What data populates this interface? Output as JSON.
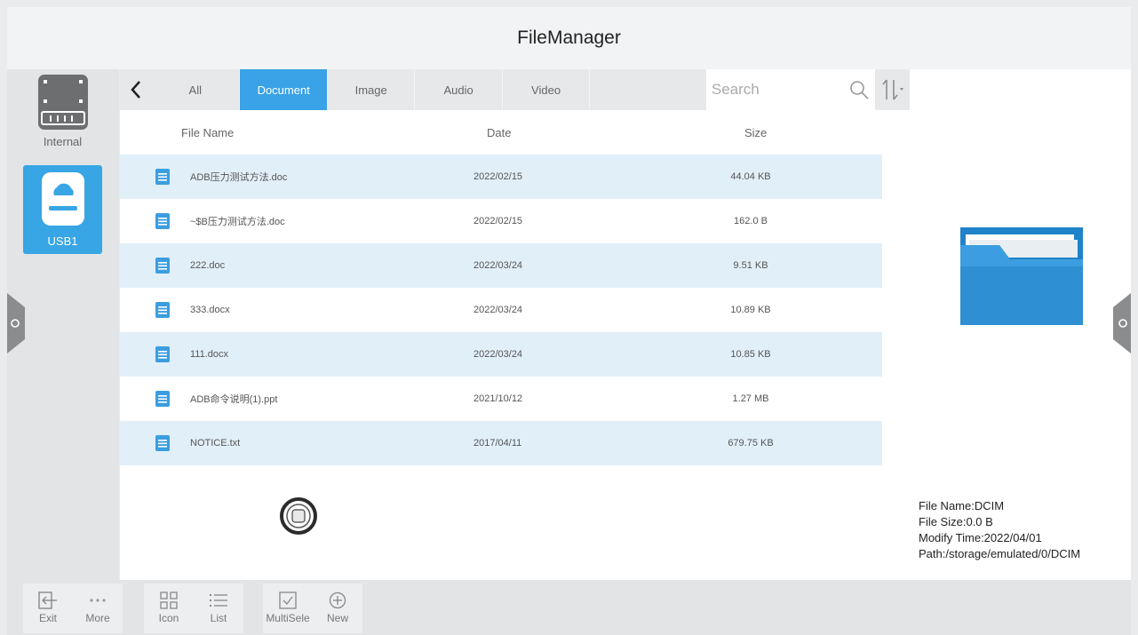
{
  "app": {
    "title": "FileManager"
  },
  "devices": [
    {
      "label": "Internal",
      "selected": false
    },
    {
      "label": "USB1",
      "selected": true
    }
  ],
  "tabs": [
    {
      "label": "All",
      "active": false
    },
    {
      "label": "Document",
      "active": true
    },
    {
      "label": "Image",
      "active": false
    },
    {
      "label": "Audio",
      "active": false
    },
    {
      "label": "Video",
      "active": false
    }
  ],
  "search": {
    "placeholder": "Search",
    "value": ""
  },
  "columns": {
    "name": "File Name",
    "date": "Date",
    "size": "Size"
  },
  "files": [
    {
      "name": "ADB压力测试方法.doc",
      "date": "2022/02/15",
      "size": "44.04 KB"
    },
    {
      "name": "~$B压力测试方法.doc",
      "date": "2022/02/15",
      "size": "162.0 B"
    },
    {
      "name": "222.doc",
      "date": "2022/03/24",
      "size": "9.51 KB"
    },
    {
      "name": "333.docx",
      "date": "2022/03/24",
      "size": "10.89 KB"
    },
    {
      "name": "111.docx",
      "date": "2022/03/24",
      "size": "10.85 KB"
    },
    {
      "name": "ADB命令说明(1).ppt",
      "date": "2021/10/12",
      "size": "1.27 MB"
    },
    {
      "name": "NOTICE.txt",
      "date": "2017/04/11",
      "size": "679.75 KB"
    }
  ],
  "details": {
    "file_name": "File Name:DCIM",
    "file_size": "File Size:0.0 B",
    "modify_time": "Modify Time:2022/04/01",
    "path": "Path:/storage/emulated/0/DCIM"
  },
  "toolbar": {
    "exit": "Exit",
    "more": "More",
    "icon": "Icon",
    "list": "List",
    "multiselect": "MultiSele",
    "new": "New"
  },
  "colors": {
    "accent": "#3aa2e6",
    "row_alt": "#e1eff9",
    "doc_icon": "#3b9ee0"
  }
}
